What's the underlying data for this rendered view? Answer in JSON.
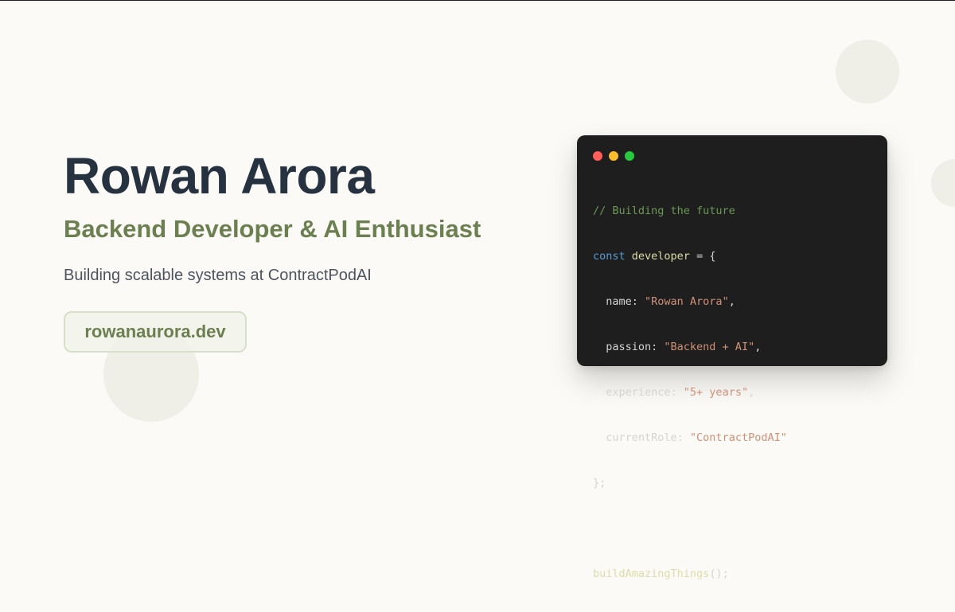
{
  "profile": {
    "name": "Rowan Arora",
    "role": "Backend Developer & AI Enthusiast",
    "tagline": "Building scalable systems at ContractPodAI",
    "website": "rowanaurora.dev"
  },
  "code_window": {
    "comment": "// Building the future",
    "keyword": "const",
    "variable": "developer",
    "assign_open": " = {",
    "fields": [
      {
        "key": "  name: ",
        "value": "\"Rowan Arora\"",
        "suffix": ","
      },
      {
        "key": "  passion: ",
        "value": "\"Backend + AI\"",
        "suffix": ","
      },
      {
        "key": "  experience: ",
        "value": "\"5+ years\"",
        "suffix": ","
      },
      {
        "key": "  currentRole: ",
        "value": "\"ContractPodAI\"",
        "suffix": ""
      }
    ],
    "close": "};",
    "call": "buildAmazingThings",
    "call_suffix": "();"
  },
  "colors": {
    "background": "#fbfaf6",
    "name": "#273241",
    "accent": "#6b7f50",
    "code_bg": "#1e1e1e"
  }
}
